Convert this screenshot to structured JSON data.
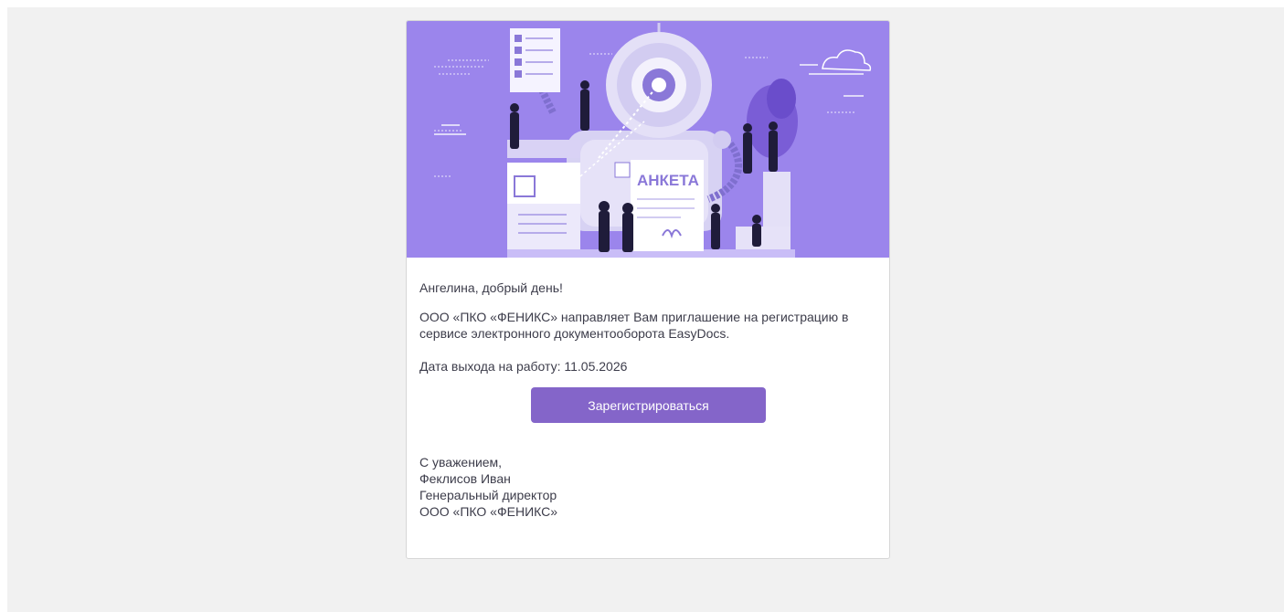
{
  "banner": {
    "form_word": "АНКЕТА"
  },
  "email": {
    "greeting": "Ангелина, добрый день!",
    "message": "ООО «ПКО «ФЕНИКС» направляет Вам приглашение на регистрацию в сервисе электронного документооборота EasyDocs.",
    "start_date": "Дата выхода на работу: 11.05.2026",
    "register_label": "Зарегистрироваться",
    "signature": {
      "closing": "С уважением,",
      "name": "Феклисов Иван",
      "position": "Генеральный директор",
      "company": "ООО «ПКО «ФЕНИКС»"
    }
  },
  "colors": {
    "page_bg": "#f1f1f1",
    "banner_bg": "#9b85ec",
    "button_bg": "#8465c9",
    "text": "#3c3c4a"
  },
  "icons": [
    "robot-illustration",
    "document-icon",
    "cloud-icon"
  ]
}
